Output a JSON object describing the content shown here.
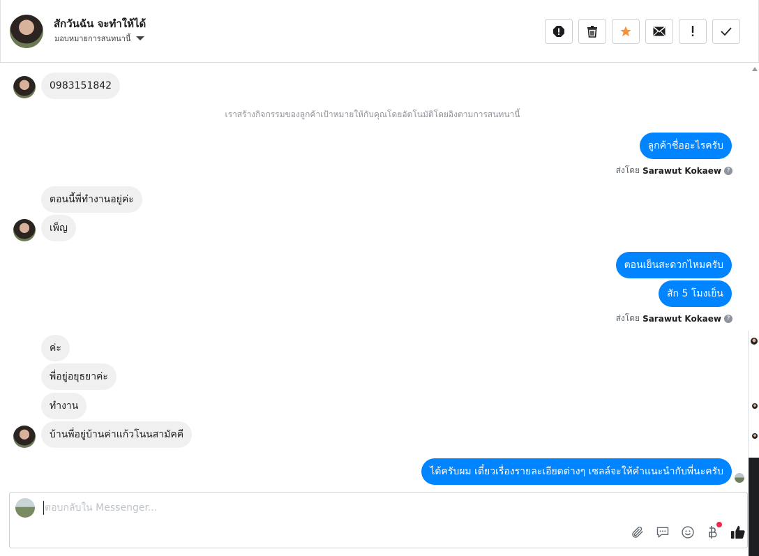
{
  "header": {
    "contact_name": "สักวันฉัน จะทำให้ได้",
    "assign_label": "มอบหมายการสนทนานี้"
  },
  "thread": {
    "msg_phone": "0983151842",
    "system_note": "เราสร้างกิจกรรมของลูกค้าเป้าหมายให้กับคุณโดยอัตโนมัติโดยอิงตามการสนทนานี้",
    "out_1": "ลูกค้าชื่ออะไรครับ",
    "sent_by_prefix": "ส่งโดย",
    "sent_by_name": "Sarawut Kokaew",
    "in_2a": "ตอนนี้พี่ทำงานอยู่ค่ะ",
    "in_2b": "เพ็ญ",
    "out_2a": "ตอนเย็นสะดวกไหมครับ",
    "out_2b": "สัก 5 โมงเย็น",
    "in_3a": "ค่ะ",
    "in_3b": "พี่อยู่อยุธยาค่ะ",
    "in_3c": "ทำงาน",
    "in_3d": "บ้านพี่อยู่บ้านค่าแก้วโนนสามัคคี",
    "out_3": "ได้ครับผม เดี๋ยวเรื่องรายละเอียดต่างๆ เซลล์จะให้คำแนะนำกับพี่นะครับ"
  },
  "composer": {
    "placeholder": "ตอบกลับใน Messenger..."
  },
  "icons": {
    "actions": [
      "alert-icon",
      "trash-icon",
      "star-icon",
      "mail-icon",
      "exclamation-icon",
      "check-icon"
    ],
    "tools": [
      "paperclip-icon",
      "chat-bubble-icon",
      "smiley-icon",
      "baht-icon",
      "thumbs-up-icon"
    ]
  },
  "colors": {
    "accent": "#0084ff",
    "star": "#f7923b",
    "incoming_bubble": "#f0f0f0"
  }
}
